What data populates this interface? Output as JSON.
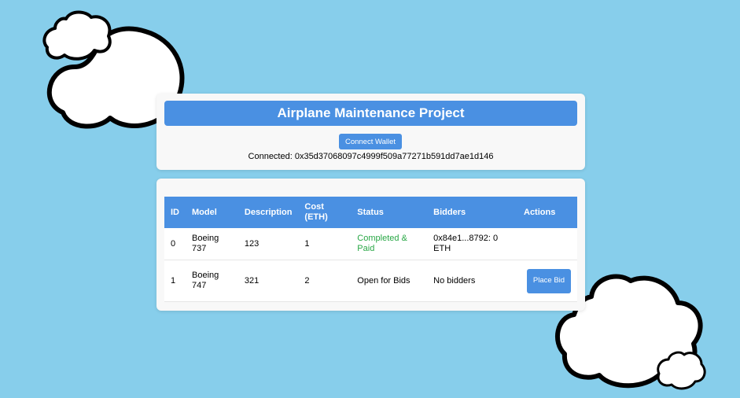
{
  "header": {
    "title": "Airplane Maintenance Project",
    "connect_button_label": "Connect Wallet",
    "connected_text": "Connected: 0x35d37068097c4999f509a77271b591dd7ae1d146"
  },
  "table": {
    "columns": [
      "ID",
      "Model",
      "Description",
      "Cost (ETH)",
      "Status",
      "Bidders",
      "Actions"
    ],
    "rows": [
      {
        "id": "0",
        "model": "Boeing 737",
        "description": "123",
        "cost": "1",
        "status": "Completed & Paid",
        "bidders": "0x84e1...8792: 0 ETH",
        "action": ""
      },
      {
        "id": "1",
        "model": "Boeing 747",
        "description": "321",
        "cost": "2",
        "status": "Open for Bids",
        "bidders": "No bidders",
        "action": "Place Bid"
      }
    ]
  },
  "colors": {
    "background": "#87ceeb",
    "accent": "#4a90e2",
    "status_completed": "#28a745"
  },
  "decorations": [
    "cloud-icon",
    "cloud-icon"
  ]
}
